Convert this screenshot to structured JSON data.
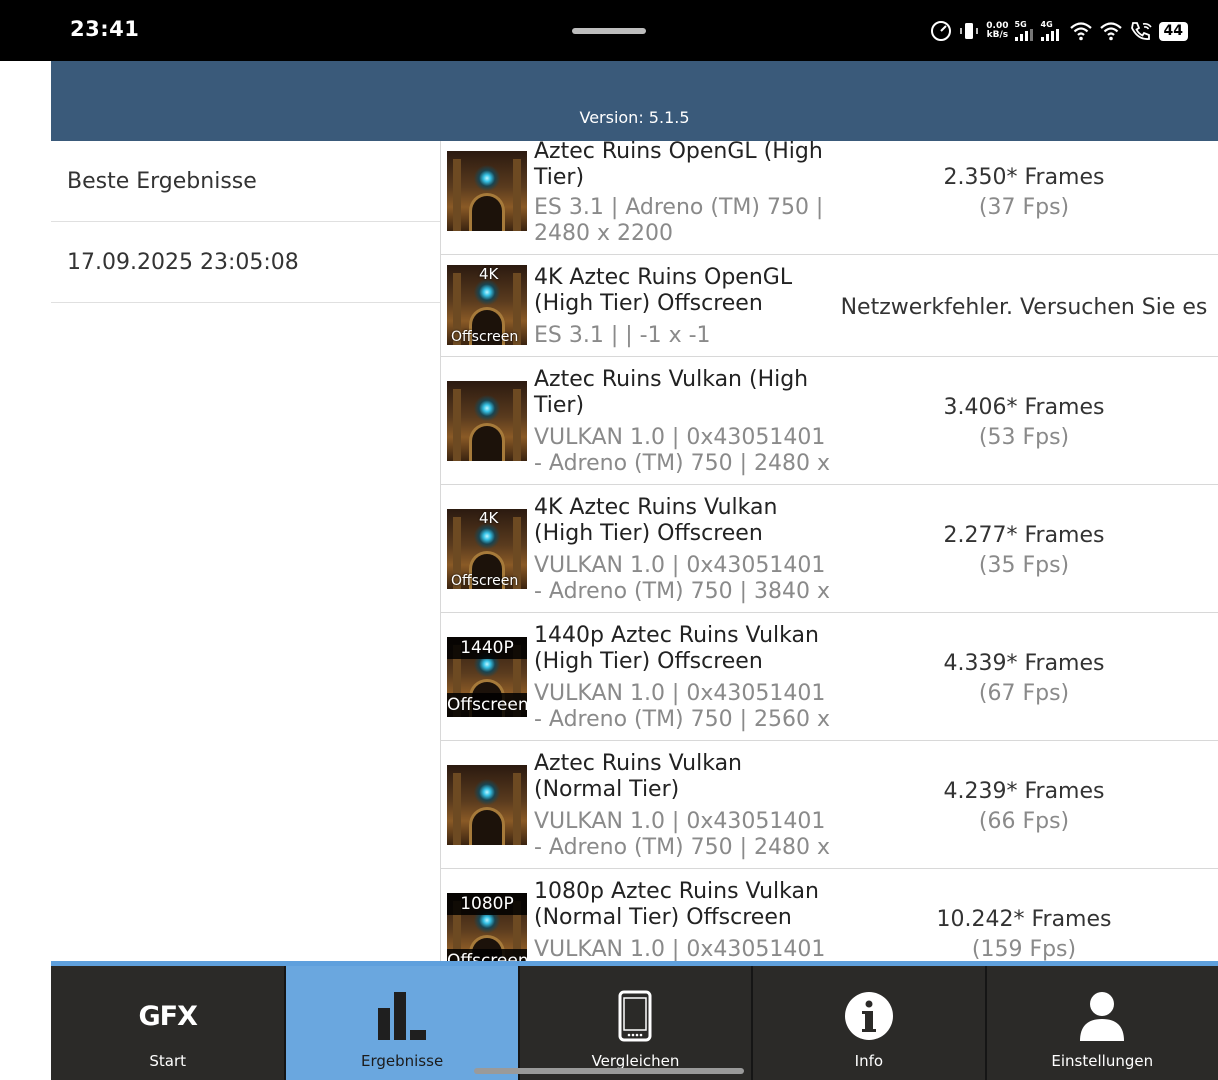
{
  "status_bar": {
    "time": "23:41",
    "net_rate_value": "0.00",
    "net_rate_unit": "kB/s",
    "sim1_tag": "5G",
    "sim2_tag": "4G",
    "battery": "44"
  },
  "header": {
    "version": "Version: 5.1.5"
  },
  "left_panel": {
    "items": [
      {
        "label": "Beste Ergebnisse"
      },
      {
        "label": "17.09.2025 23:05:08"
      }
    ]
  },
  "results": [
    {
      "title_1": "Aztec Ruins OpenGL (High",
      "title_2": "Tier)",
      "sub_1": "ES 3.1 | Adreno (TM) 750 |",
      "sub_2": "2480 x 2200",
      "score": "2.350* Frames",
      "fps": "(37 Fps)"
    },
    {
      "badge_top": "4K",
      "badge_bottom": "Offscreen",
      "title_1": "4K Aztec Ruins OpenGL",
      "title_2": "(High Tier) Offscreen",
      "sub_1": "ES 3.1 |  | -1 x -1",
      "score": "Netzwerkfehler. Versuchen Sie es"
    },
    {
      "title_1": "Aztec Ruins Vulkan (High",
      "title_2": "Tier)",
      "sub_1": "VULKAN 1.0 | 0x43051401",
      "sub_2": "- Adreno (TM) 750 | 2480 x",
      "score": "3.406* Frames",
      "fps": "(53 Fps)"
    },
    {
      "badge_top": "4K",
      "badge_bottom": "Offscreen",
      "title_1": "4K Aztec Ruins Vulkan",
      "title_2": "(High Tier) Offscreen",
      "sub_1": "VULKAN 1.0 | 0x43051401",
      "sub_2": "- Adreno (TM) 750 | 3840 x",
      "score": "2.277* Frames",
      "fps": "(35 Fps)"
    },
    {
      "badge_top": "1440P",
      "badge_bottom": "Offscreen",
      "title_1": "1440p Aztec Ruins Vulkan",
      "title_2": "(High Tier) Offscreen",
      "sub_1": "VULKAN 1.0 | 0x43051401",
      "sub_2": "- Adreno (TM) 750 | 2560 x",
      "score": "4.339* Frames",
      "fps": "(67 Fps)"
    },
    {
      "title_1": "Aztec Ruins Vulkan",
      "title_2": "(Normal Tier)",
      "sub_1": "VULKAN 1.0 | 0x43051401",
      "sub_2": "- Adreno (TM) 750 | 2480 x",
      "score": "4.239* Frames",
      "fps": "(66 Fps)"
    },
    {
      "badge_top": "1080P",
      "badge_bottom": "Offscreen",
      "title_1": "1080p Aztec Ruins Vulkan",
      "title_2": "(Normal Tier) Offscreen",
      "sub_1": "VULKAN 1.0 | 0x43051401",
      "score": "10.242* Frames",
      "fps": "(159 Fps)"
    }
  ],
  "bottom_nav": {
    "logo": "GFX",
    "tabs": [
      {
        "label": "Start",
        "icon": "gfx-logo-icon"
      },
      {
        "label": "Ergebnisse",
        "icon": "bar-chart-icon",
        "active": true
      },
      {
        "label": "Vergleichen",
        "icon": "phone-icon"
      },
      {
        "label": "Info",
        "icon": "info-icon"
      },
      {
        "label": "Einstellungen",
        "icon": "user-icon"
      }
    ]
  },
  "colors": {
    "header": "#3a5a7a",
    "nav_background": "#2b2a28",
    "nav_active": "#6aa7df",
    "nav_top_line": "#5fa0dd"
  }
}
